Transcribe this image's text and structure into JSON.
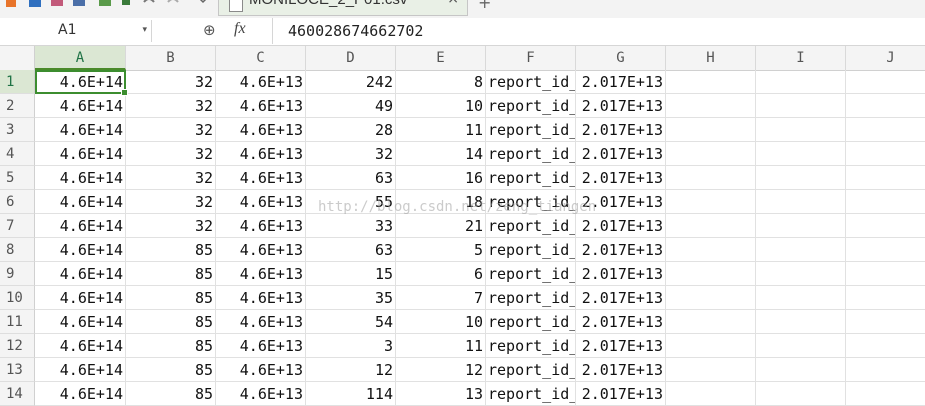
{
  "window": {
    "tab_title": "MONILOCE_2_P01.csv",
    "tab_close": "×",
    "new_tab": "+"
  },
  "formula_bar": {
    "name_box": "A1",
    "name_box_arrow": "▾",
    "zoom_icon": "⊕",
    "fx_label": "fx",
    "value": "460028674662702"
  },
  "sheet": {
    "active_cell": "A1",
    "selection_color": "#3c8d2f",
    "columns": [
      "A",
      "B",
      "C",
      "D",
      "E",
      "F",
      "G",
      "H",
      "I",
      "J"
    ],
    "rows": [
      {
        "num": "1",
        "cells": [
          "4.6E+14",
          "32",
          "4.6E+13",
          "242",
          "8",
          "report_id_",
          "2.017E+13"
        ]
      },
      {
        "num": "2",
        "cells": [
          "4.6E+14",
          "32",
          "4.6E+13",
          "49",
          "10",
          "report_id_",
          "2.017E+13"
        ]
      },
      {
        "num": "3",
        "cells": [
          "4.6E+14",
          "32",
          "4.6E+13",
          "28",
          "11",
          "report_id_",
          "2.017E+13"
        ]
      },
      {
        "num": "4",
        "cells": [
          "4.6E+14",
          "32",
          "4.6E+13",
          "32",
          "14",
          "report_id_",
          "2.017E+13"
        ]
      },
      {
        "num": "5",
        "cells": [
          "4.6E+14",
          "32",
          "4.6E+13",
          "63",
          "16",
          "report_id_",
          "2.017E+13"
        ]
      },
      {
        "num": "6",
        "cells": [
          "4.6E+14",
          "32",
          "4.6E+13",
          "55",
          "18",
          "report_id_",
          "2.017E+13"
        ]
      },
      {
        "num": "7",
        "cells": [
          "4.6E+14",
          "32",
          "4.6E+13",
          "33",
          "21",
          "report_id_",
          "2.017E+13"
        ]
      },
      {
        "num": "8",
        "cells": [
          "4.6E+14",
          "85",
          "4.6E+13",
          "63",
          "5",
          "report_id_",
          "2.017E+13"
        ]
      },
      {
        "num": "9",
        "cells": [
          "4.6E+14",
          "85",
          "4.6E+13",
          "15",
          "6",
          "report_id_",
          "2.017E+13"
        ]
      },
      {
        "num": "10",
        "cells": [
          "4.6E+14",
          "85",
          "4.6E+13",
          "35",
          "7",
          "report_id_",
          "2.017E+13"
        ]
      },
      {
        "num": "11",
        "cells": [
          "4.6E+14",
          "85",
          "4.6E+13",
          "54",
          "10",
          "report_id_",
          "2.017E+13"
        ]
      },
      {
        "num": "12",
        "cells": [
          "4.6E+14",
          "85",
          "4.6E+13",
          "3",
          "11",
          "report_id_",
          "2.017E+13"
        ]
      },
      {
        "num": "13",
        "cells": [
          "4.6E+14",
          "85",
          "4.6E+13",
          "12",
          "12",
          "report_id_",
          "2.017E+13"
        ]
      },
      {
        "num": "14",
        "cells": [
          "4.6E+14",
          "85",
          "4.6E+13",
          "114",
          "13",
          "report_id_",
          "2.017E+13"
        ]
      }
    ]
  },
  "watermark": "http://blog.csdn.net/zeng_tiangen"
}
